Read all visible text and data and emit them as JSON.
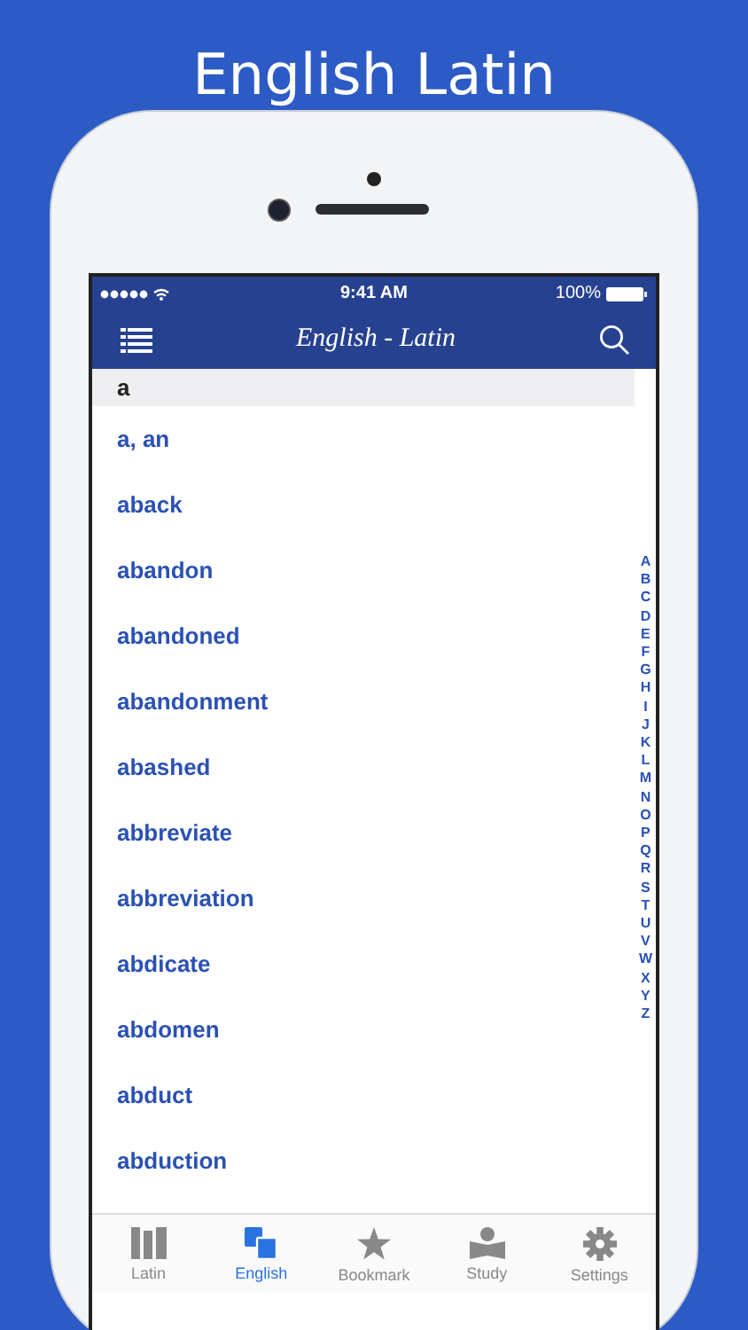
{
  "headline": "English Latin",
  "status_bar": {
    "time": "9:41 AM",
    "battery": "100%"
  },
  "nav": {
    "title": "English - Latin"
  },
  "section": "a",
  "words": [
    "a, an",
    "aback",
    "abandon",
    "abandoned",
    "abandonment",
    "abashed",
    "abbreviate",
    "abbreviation",
    "abdicate",
    "abdomen",
    "abduct",
    "abduction"
  ],
  "index": [
    "A",
    "B",
    "C",
    "D",
    "E",
    "F",
    "G",
    "H",
    "I",
    "J",
    "K",
    "L",
    "M",
    "N",
    "O",
    "P",
    "Q",
    "R",
    "S",
    "T",
    "U",
    "V",
    "W",
    "X",
    "Y",
    "Z"
  ],
  "tabs": [
    {
      "label": "Latin",
      "kind": "books",
      "selected": false
    },
    {
      "label": "English",
      "kind": "cards",
      "selected": true
    },
    {
      "label": "Bookmark",
      "kind": "star",
      "selected": false
    },
    {
      "label": "Study",
      "kind": "reader",
      "selected": false
    },
    {
      "label": "Settings",
      "kind": "gear",
      "selected": false
    }
  ]
}
